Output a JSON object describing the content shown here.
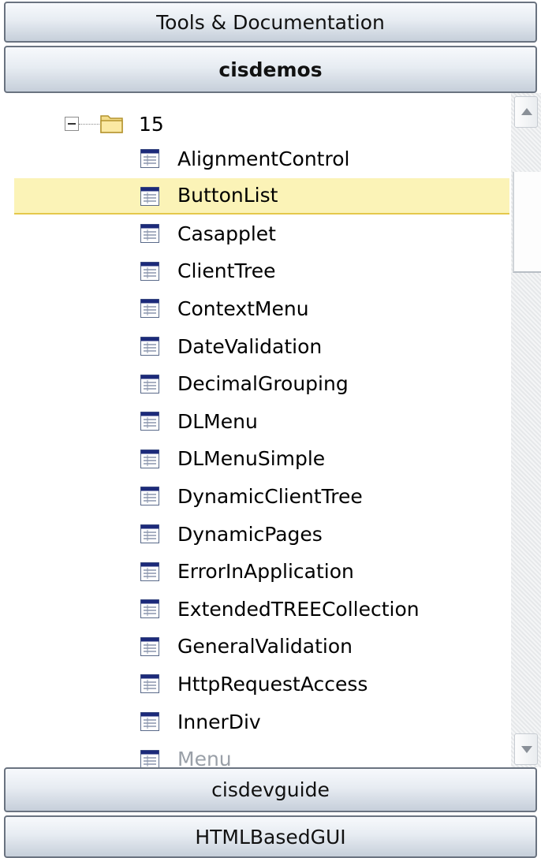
{
  "accordion": {
    "tools_label": "Tools & Documentation",
    "cisdemos_label": "cisdemos",
    "cisdevguide_label": "cisdevguide",
    "htmlbasedgui_label": "HTMLBasedGUI"
  },
  "tree": {
    "folder": {
      "label": "15",
      "expander_icon": "minus-box-icon",
      "icon": "folder-open-icon"
    },
    "item_icon": "form-table-icon",
    "selected_index": 1,
    "items": [
      "AlignmentControl",
      "ButtonList",
      "Casapplet",
      "ClientTree",
      "ContextMenu",
      "DateValidation",
      "DecimalGrouping",
      "DLMenu",
      "DLMenuSimple",
      "DynamicClientTree",
      "DynamicPages",
      "ErrorInApplication",
      "ExtendedTREECollection",
      "GeneralValidation",
      "HttpRequestAccess",
      "InnerDiv",
      "Menu"
    ]
  },
  "colors": {
    "selection_bg": "#fbf3b7",
    "selection_border": "#e5c84c",
    "bar_border": "#6a7380",
    "icon_header": "#1c2a7a"
  }
}
